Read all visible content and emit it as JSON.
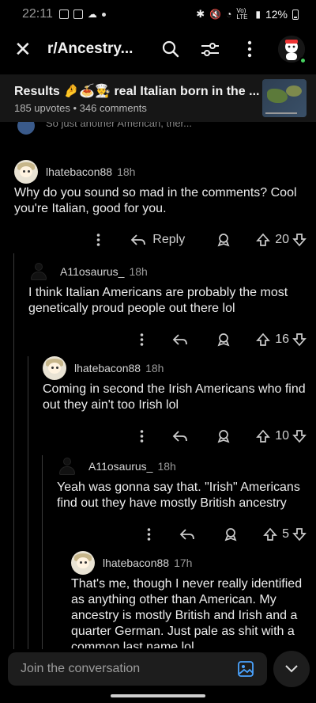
{
  "status_bar": {
    "time": "22:11",
    "battery": "12%",
    "network": "Vo) LTE"
  },
  "header": {
    "subreddit": "r/Ancestry..."
  },
  "post": {
    "title": "Results 🤌🍝👨‍🍳 real Italian born in the ...",
    "upvotes": "185 upvotes",
    "comments": "346 comments",
    "separator": "•"
  },
  "peek": {
    "text": "...",
    "preview": "So just another American, ther..."
  },
  "comments": [
    {
      "user": "lhatebacon88",
      "time": "18h",
      "body": "Why do you sound so mad in the comments? Cool you're Italian, good for you.",
      "reply_label": "Reply",
      "score": "20"
    },
    {
      "user": "A11osaurus_",
      "time": "18h",
      "body": "I think Italian Americans are probably the most genetically proud people out there lol",
      "score": "16"
    },
    {
      "user": "lhatebacon88",
      "time": "18h",
      "body": "Coming in second the Irish Americans who find out they ain't too Irish lol",
      "score": "10"
    },
    {
      "user": "A11osaurus_",
      "time": "18h",
      "body": "Yeah was gonna say that. \"Irish\" Americans find out they have mostly British ancestry",
      "score": "5"
    },
    {
      "user": "lhatebacon88",
      "time": "17h",
      "body": "That's me, though I never really identified as anything other than American. My ancestry is mostly British and Irish and a quarter German. Just pale as shit with a common last name lol"
    }
  ],
  "composer": {
    "placeholder": "Join the conversation"
  },
  "colors": {
    "background": "#000000",
    "surface": "#1d1d1d",
    "online": "#46d160",
    "accent_icon": "#4aa3ff"
  }
}
